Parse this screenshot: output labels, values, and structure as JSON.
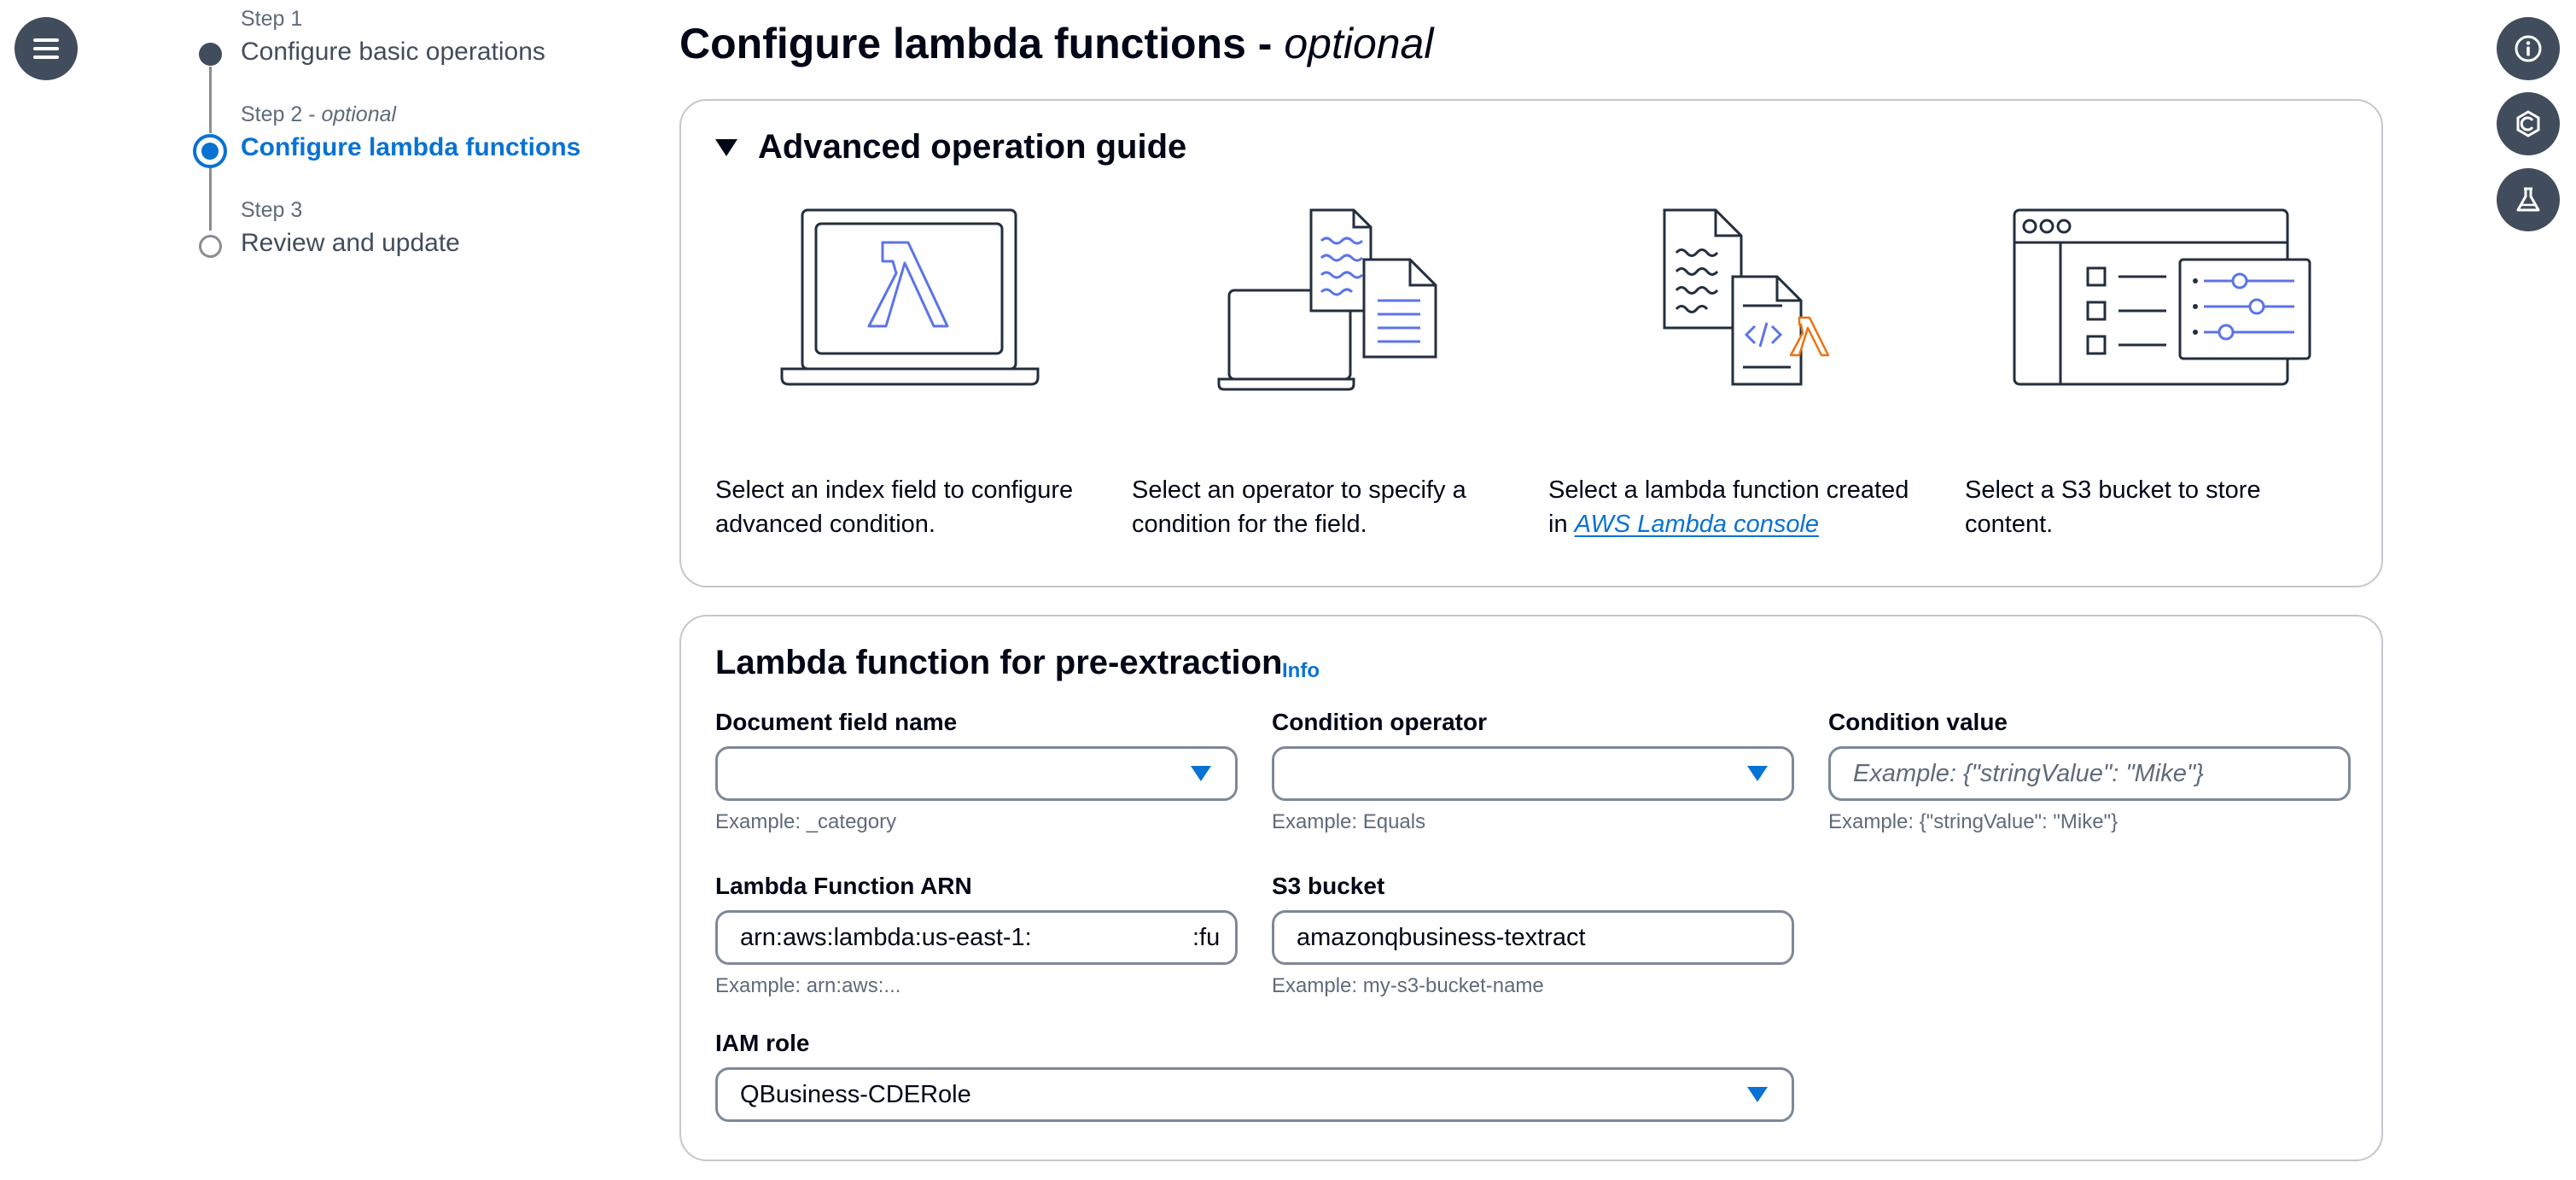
{
  "steps": [
    {
      "label": "Step 1",
      "title": "Configure basic operations"
    },
    {
      "label": "Step 2 - ",
      "label_optional": "optional",
      "title": "Configure lambda functions"
    },
    {
      "label": "Step 3",
      "title": "Review and update"
    }
  ],
  "page": {
    "title": "Configure lambda functions - ",
    "title_optional": "optional"
  },
  "guide": {
    "heading": "Advanced operation guide",
    "items": [
      {
        "text": "Select an index field to configure advanced condition.",
        "icon": "laptop-lambda-icon"
      },
      {
        "text": "Select an operator to specify a condition for the field.",
        "icon": "computer-documents-icon"
      },
      {
        "text": "Select a lambda function created in ",
        "link": "AWS Lambda console",
        "icon": "code-document-lambda-icon"
      },
      {
        "text": "Select a S3 bucket to store content.",
        "icon": "settings-window-icon"
      }
    ]
  },
  "lambda_section": {
    "title": "Lambda function for pre-extraction",
    "info": "Info",
    "document_field": {
      "label": "Document field name",
      "value": "",
      "hint": "Example: _category"
    },
    "condition_operator": {
      "label": "Condition operator",
      "value": "",
      "hint": "Example: Equals"
    },
    "condition_value": {
      "label": "Condition value",
      "placeholder": "Example: {\"stringValue\": \"Mike\"}",
      "hint": "Example: {\"stringValue\": \"Mike\"}"
    },
    "lambda_arn": {
      "label": "Lambda Function ARN",
      "value": "arn:aws:lambda:us-east-1:",
      "value_tail": ":fu",
      "hint": "Example: arn:aws:..."
    },
    "s3_bucket": {
      "label": "S3 bucket",
      "value": "amazonqbusiness-textract",
      "hint": "Example: my-s3-bucket-name"
    },
    "iam_role": {
      "label": "IAM role",
      "value": "QBusiness-CDERole"
    }
  },
  "colors": {
    "accent": "#0972d3",
    "dark": "#414d5c",
    "text": "#000716"
  },
  "icons": [
    "menu-icon",
    "info-icon",
    "hexagon-icon",
    "flask-icon"
  ]
}
